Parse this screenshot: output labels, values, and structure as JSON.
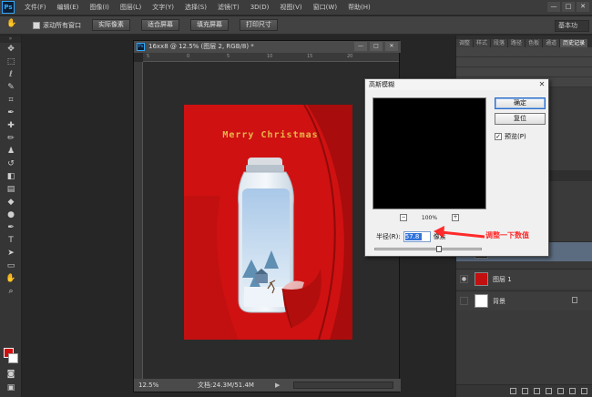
{
  "app": {
    "logo": "Ps"
  },
  "menubar": {
    "items": [
      "文件(F)",
      "编辑(E)",
      "图像(I)",
      "图层(L)",
      "文字(Y)",
      "选择(S)",
      "滤镜(T)",
      "3D(D)",
      "视图(V)",
      "窗口(W)",
      "帮助(H)"
    ],
    "window_buttons": [
      "—",
      "□",
      "✕"
    ]
  },
  "options": {
    "scroll_all_label": "滚动所有窗口",
    "buttons": [
      "实际像素",
      "适合屏幕",
      "填充屏幕",
      "打印尺寸"
    ],
    "workspace": "基本功"
  },
  "document": {
    "title": "16xx8 @ 12.5% (图层 2, RGB/8) *",
    "ruler_ticks": [
      "5",
      "0",
      "5",
      "10",
      "15",
      "20"
    ],
    "zoom": "12.5%",
    "doc_info": "文档:24.3M/51.4M",
    "canvas_text": "Merry Christmas",
    "colors": {
      "red": "#cf1111",
      "gold": "#e8b84a"
    }
  },
  "dialog": {
    "title": "高斯模糊",
    "ok_label": "确定",
    "reset_label": "复位",
    "preview_label": "预览(P)",
    "preview_checked": true,
    "zoom_percent": "100%",
    "radius_label": "半径(R):",
    "radius_value": "57.8",
    "radius_unit": "像素",
    "slider_fraction": 0.6
  },
  "annotation": {
    "text": "调整一下数值",
    "color": "#ff2a2a"
  },
  "panels": {
    "tabs": [
      "调整",
      "样式",
      "段落",
      "路径",
      "色板",
      "通道",
      "历史记录"
    ],
    "layers": [
      {
        "name": "图层 1",
        "thumb": "#c21010"
      },
      {
        "name": "背景",
        "thumb": "#ffffff"
      }
    ]
  }
}
